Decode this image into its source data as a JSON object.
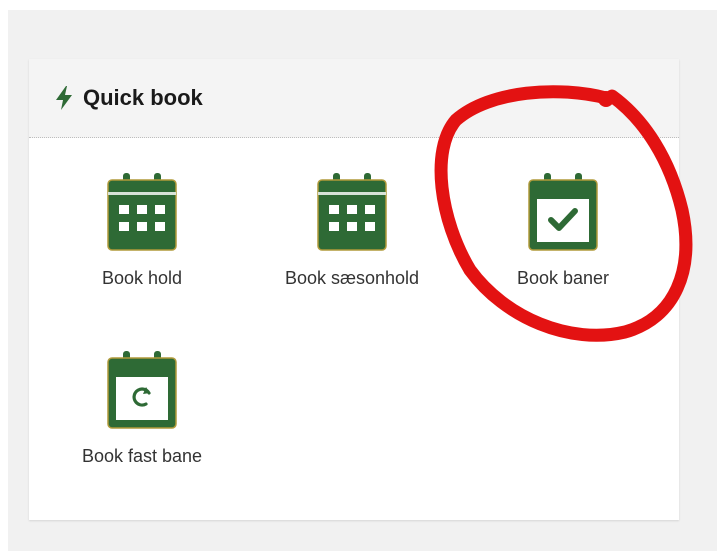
{
  "panel": {
    "title": "Quick book",
    "tiles": [
      {
        "label": "Book hold",
        "icon": "calendar-grid-icon"
      },
      {
        "label": "Book sæsonhold",
        "icon": "calendar-grid-icon"
      },
      {
        "label": "Book baner",
        "icon": "calendar-check-icon"
      },
      {
        "label": "Book fast bane",
        "icon": "calendar-repeat-icon"
      }
    ]
  },
  "colors": {
    "icon_green": "#2e6a35",
    "icon_border": "#b09a3a",
    "annotation_red": "#e31212"
  }
}
